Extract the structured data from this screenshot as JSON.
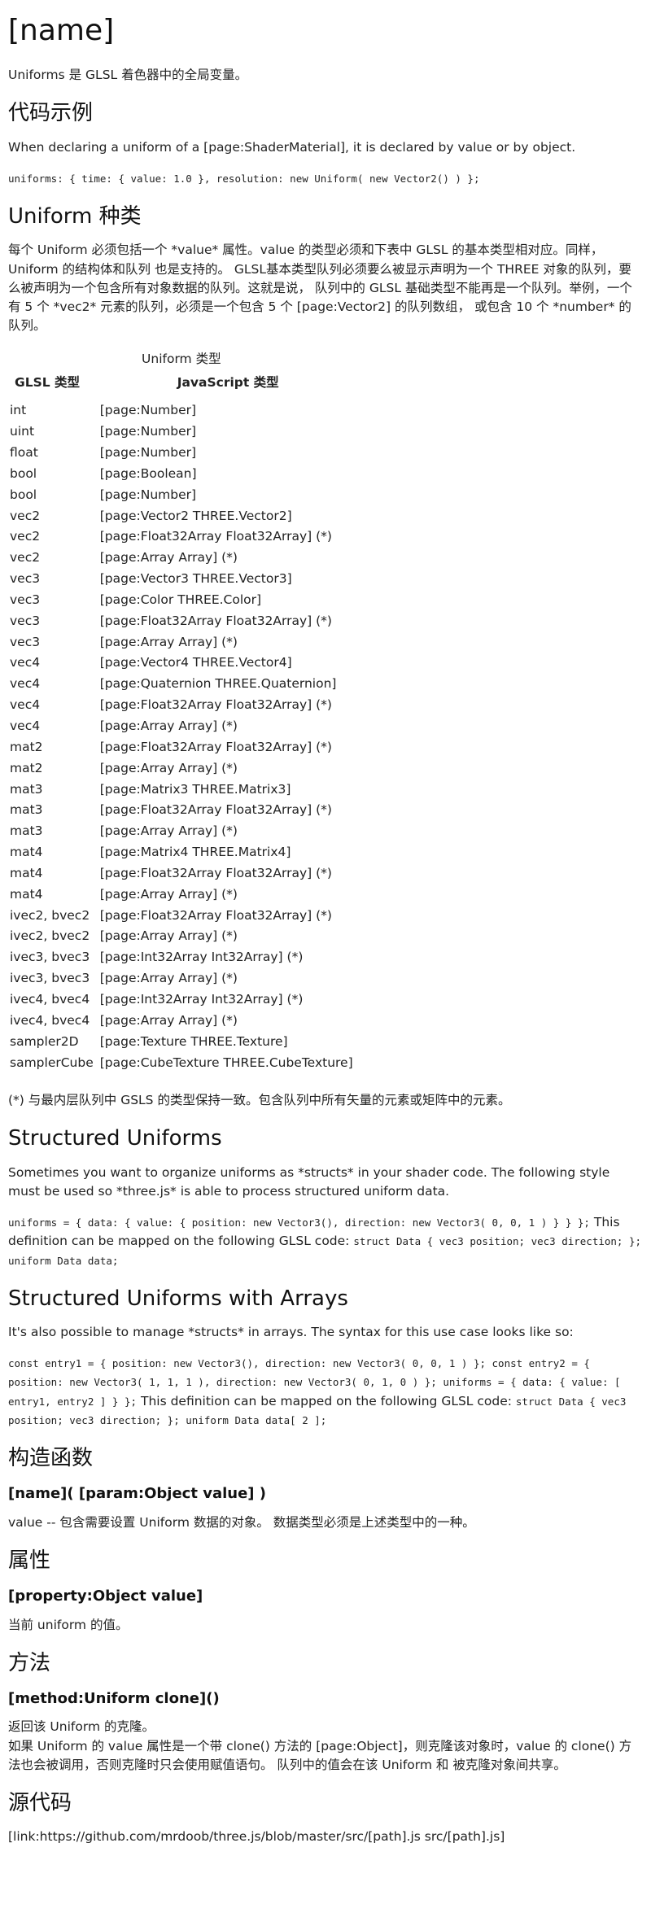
{
  "title": "[name]",
  "intro": "Uniforms 是 GLSL 着色器中的全局变量。",
  "example": {
    "heading": "代码示例",
    "text": "When declaring a uniform of a [page:ShaderMaterial], it is declared by value or by object.",
    "code": "uniforms: { time: { value: 1.0 }, resolution: new Uniform( new Vector2() ) };"
  },
  "types": {
    "heading": "Uniform 种类",
    "text": "每个 Uniform 必须包括一个 *value* 属性。value 的类型必须和下表中 GLSL 的基本类型相对应。同样，Uniform 的结构体和队列 也是支持的。 GLSL基本类型队列必须要么被显示声明为一个 THREE 对象的队列，要么被声明为一个包含所有对象数据的队列。这就是说， 队列中的 GLSL 基础类型不能再是一个队列。举例，一个有 5 个 *vec2* 元素的队列，必须是一个包含 5 个 [page:Vector2] 的队列数组， 或包含 10 个 *number* 的队列。",
    "table_caption": "Uniform 类型",
    "col_glsl": "GLSL 类型",
    "col_js": "JavaScript 类型",
    "rows": [
      [
        "int",
        "[page:Number]"
      ],
      [
        "uint",
        "[page:Number]"
      ],
      [
        "float",
        "[page:Number]"
      ],
      [
        "bool",
        "[page:Boolean]"
      ],
      [
        "bool",
        "[page:Number]"
      ],
      [
        "vec2",
        "[page:Vector2 THREE.Vector2]"
      ],
      [
        "vec2",
        "[page:Float32Array Float32Array] (*)"
      ],
      [
        "vec2",
        "[page:Array Array] (*)"
      ],
      [
        "vec3",
        "[page:Vector3 THREE.Vector3]"
      ],
      [
        "vec3",
        "[page:Color THREE.Color]"
      ],
      [
        "vec3",
        "[page:Float32Array Float32Array] (*)"
      ],
      [
        "vec3",
        "[page:Array Array] (*)"
      ],
      [
        "vec4",
        "[page:Vector4 THREE.Vector4]"
      ],
      [
        "vec4",
        "[page:Quaternion THREE.Quaternion]"
      ],
      [
        "vec4",
        "[page:Float32Array Float32Array] (*)"
      ],
      [
        "vec4",
        "[page:Array Array] (*)"
      ],
      [
        "mat2",
        "[page:Float32Array Float32Array] (*)"
      ],
      [
        "mat2",
        "[page:Array Array] (*)"
      ],
      [
        "mat3",
        "[page:Matrix3 THREE.Matrix3]"
      ],
      [
        "mat3",
        "[page:Float32Array Float32Array] (*)"
      ],
      [
        "mat3",
        "[page:Array Array] (*)"
      ],
      [
        "mat4",
        "[page:Matrix4 THREE.Matrix4]"
      ],
      [
        "mat4",
        "[page:Float32Array Float32Array] (*)"
      ],
      [
        "mat4",
        "[page:Array Array] (*)"
      ],
      [
        "ivec2, bvec2",
        "[page:Float32Array Float32Array] (*)"
      ],
      [
        "ivec2, bvec2",
        "[page:Array Array] (*)"
      ],
      [
        "ivec3, bvec3",
        "[page:Int32Array Int32Array] (*)"
      ],
      [
        "ivec3, bvec3",
        "[page:Array Array] (*)"
      ],
      [
        "ivec4, bvec4",
        "[page:Int32Array Int32Array] (*)"
      ],
      [
        "ivec4, bvec4",
        "[page:Array Array] (*)"
      ],
      [
        "sampler2D",
        "[page:Texture THREE.Texture]"
      ],
      [
        "samplerCube",
        "[page:CubeTexture THREE.CubeTexture]"
      ]
    ],
    "footnote": "(*) 与最内层队列中 GSLS 的类型保持一致。包含队列中所有矢量的元素或矩阵中的元素。"
  },
  "structured": {
    "heading": "Structured Uniforms",
    "text": "Sometimes you want to organize uniforms as *structs* in your shader code. The following style must be used so *three.js* is able to process structured uniform data.",
    "code1": "uniforms = { data: { value: { position: new Vector3(), direction: new Vector3( 0, 0, 1 ) } } };",
    "mid": " This definition can be mapped on the following GLSL code: ",
    "code2": "struct Data { vec3 position; vec3 direction; }; uniform Data data;"
  },
  "structured_arrays": {
    "heading": "Structured Uniforms with Arrays",
    "text": "It's also possible to manage *structs* in arrays. The syntax for this use case looks like so:",
    "code1": "const entry1 = { position: new Vector3(), direction: new Vector3( 0, 0, 1 ) }; const entry2 = { position: new Vector3( 1, 1, 1 ), direction: new Vector3( 0, 1, 0 ) }; uniforms = { data: { value: [ entry1, entry2 ] } };",
    "mid": " This definition can be mapped on the following GLSL code: ",
    "code2": "struct Data { vec3 position; vec3 direction; }; uniform Data data[ 2 ];"
  },
  "constructor": {
    "heading": "构造函数",
    "signature": "[name]( [param:Object value] )",
    "text": "value -- 包含需要设置 Uniform 数据的对象。 数据类型必须是上述类型中的一种。"
  },
  "properties": {
    "heading": "属性",
    "item": "[property:Object value]",
    "text": "当前 uniform 的值。"
  },
  "methods": {
    "heading": "方法",
    "item": "[method:Uniform clone]()",
    "line1": "返回该 Uniform 的克隆。",
    "line2": "如果 Uniform 的 value 属性是一个带 clone() 方法的 [page:Object]，则克隆该对象时，value 的 clone() 方法也会被调用，否则克隆时只会使用赋值语句。 队列中的值会在该 Uniform 和 被克隆对象间共享。"
  },
  "source": {
    "heading": "源代码",
    "link": "[link:https://github.com/mrdoob/three.js/blob/master/src/[path].js src/[path].js]"
  }
}
